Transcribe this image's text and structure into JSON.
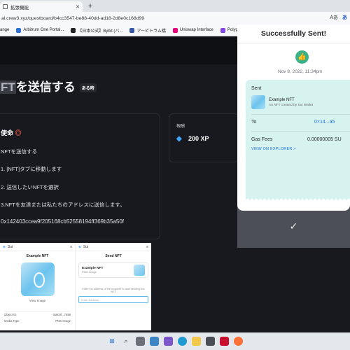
{
  "browser": {
    "tab_title": "拡張機能",
    "new_tab": "+",
    "url": "al.crew3.xyz/questboard/b4cc3547-be88-40dd-ad18-2d8e0c168d99",
    "bookmarks": [
      "ange",
      "Arbitrum One Portal...",
      "【日本公式】Bybit (バ...",
      "アービトラム橋",
      "Uniswap Interface",
      "Polygon"
    ],
    "icons": {
      "reader": "Aあ",
      "translate": "あ"
    }
  },
  "page": {
    "title_hl": "FT",
    "title_rest": "を送信する",
    "tag": "ある時",
    "mission_heading": "使命",
    "steps": [
      "NFTを送信する",
      "1. [NFT]タブに移動します",
      "2. 送信したいNFTを選択",
      "3.NFTを友達または私たちのアドレスに送信します。",
      "0x142403ccea9f205168cb52558194ff369b35a50f"
    ],
    "reward_label": "報酬",
    "reward_value": "200 XP"
  },
  "thumbnail": {
    "left": {
      "brand": "Sui",
      "title": "Example NFT",
      "view": "View Image",
      "object_id_label": "Object ID",
      "object_id": "0x602f...7558",
      "media_label": "Media Type",
      "media": "PNG Image"
    },
    "right": {
      "brand": "Sui",
      "title": "Send NFT",
      "nft_name": "Example NFT",
      "nft_type": "PNG Image",
      "instruction": "Enter the address of the recipient to start sending the NFT",
      "address_placeholder": "Enter Address"
    }
  },
  "popup": {
    "title": "Successfully Sent!",
    "date": "Nov 8, 2022, 11:34pm",
    "sent_label": "Sent",
    "nft_name": "Example NFT",
    "nft_desc": "An NFT created by Sui Wallet",
    "to_label": "To",
    "to_value": "0×14...a5",
    "gas_label": "Gas Fees",
    "gas_value": "0.00000005 SU",
    "explorer": "VIEW ON EXPLORER  >",
    "confirm": "✓"
  },
  "colors": {
    "accent": "#39b287",
    "link": "#1f6fe3",
    "receipt": "#d6f3ef",
    "page_bg": "#17191e"
  }
}
